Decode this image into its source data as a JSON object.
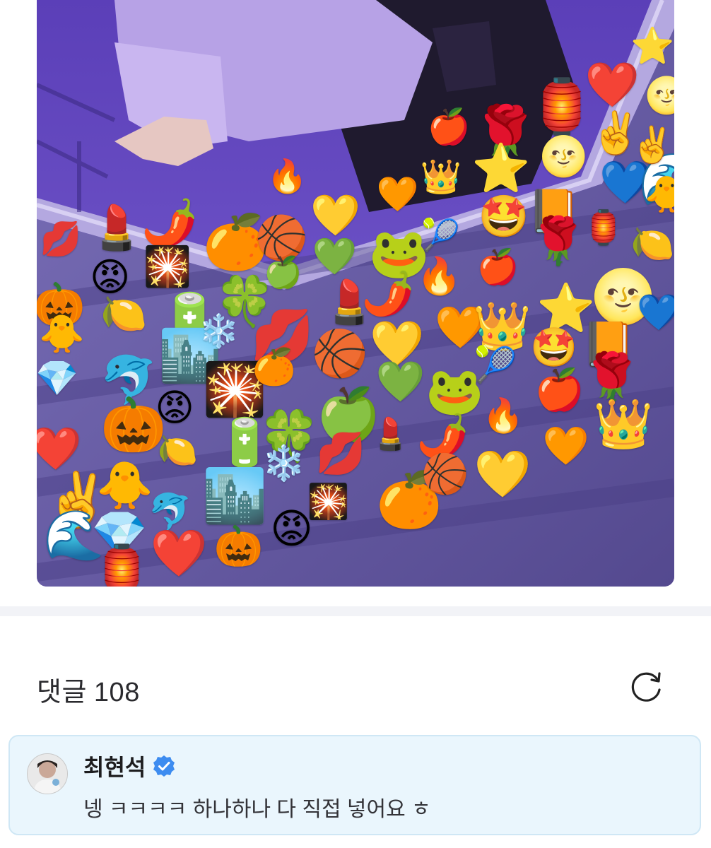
{
  "post": {
    "image": {
      "icon": "photo-emoji-collage",
      "palette": {
        "hoodie": "#b39ddb",
        "shadow": "#3a2a6e",
        "frame": "#a99bd6",
        "floor": "#5f5597"
      },
      "emojis": [
        "💋",
        "💄",
        "🌶️",
        "🔥",
        "🍎",
        "🌹",
        "🏮",
        "❤️",
        "🎃",
        "😡",
        "🎇",
        "🍊",
        "🏀",
        "💛",
        "🧡",
        "👑",
        "⭐",
        "🌝",
        "✌️",
        "🐥",
        "🍋",
        "🔋",
        "🍀",
        "🍏",
        "💚",
        "🐸",
        "🎾",
        "🤩",
        "📙",
        "💙",
        "🌊",
        "💎",
        "🐬",
        "🏙️",
        "❄️"
      ]
    }
  },
  "comments": {
    "title": "댓글",
    "count": "108",
    "refresh_icon": "refresh-icon",
    "items": [
      {
        "author": "최현석",
        "verified": true,
        "verified_color": "#3d8cf0",
        "avatar_icon": "avatar",
        "text": "넹 ㅋㅋㅋㅋ 하나하나 다 직접 넣어요 ㅎ"
      }
    ]
  },
  "colors": {
    "card_bg": "#eaf6fd",
    "card_border": "#cfe7f5",
    "divider": "#f2f3f7",
    "text": "#2a2a2e"
  }
}
